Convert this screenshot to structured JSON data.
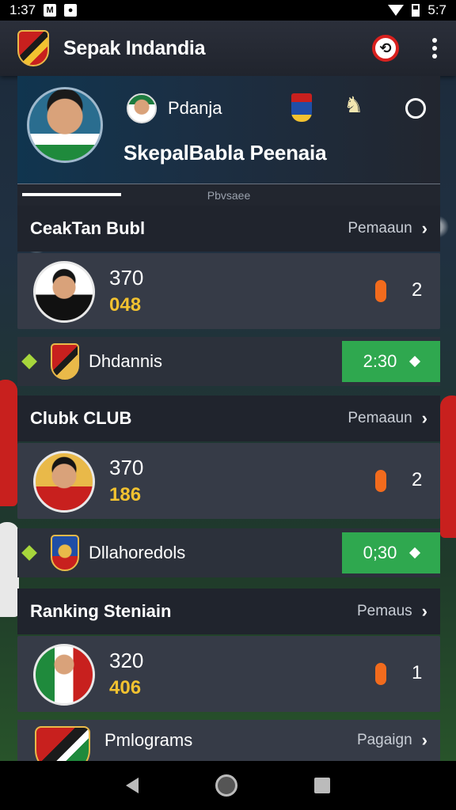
{
  "status_bar": {
    "time_left": "1:37",
    "time_right": "5:7",
    "icon_a": "M"
  },
  "app_bar": {
    "title": "Sepak Indandia",
    "clock_icon": "clock-icon",
    "menu_icon": "more-vert-icon"
  },
  "profile": {
    "name_primary": "Pdanja",
    "name_secondary": "SkepalBabla Peenaia",
    "progress_label": "Pbvsaee",
    "progress_fraction": 0.24
  },
  "sections": [
    {
      "title": "CeakTan Bubl",
      "link": "Pemaaun",
      "stat": {
        "value_top": "370",
        "value_bottom": "048",
        "count": "2"
      },
      "match": {
        "name": "Dhdannis",
        "score": "2:30"
      }
    },
    {
      "title": "Clubk CLUB",
      "link": "Pemaaun",
      "stat": {
        "value_top": "370",
        "value_bottom": "186",
        "count": "2"
      },
      "match": {
        "name": "Dllahoredols",
        "score": "0;30"
      }
    },
    {
      "title": "Ranking Steniain",
      "link": "Pemaus",
      "stat": {
        "value_top": "320",
        "value_bottom": "406",
        "count": "1"
      }
    }
  ],
  "last_row": {
    "name": "Pmlograms",
    "link": "Pagaign"
  },
  "colors": {
    "accent_green": "#2fa84f",
    "accent_orange": "#f26b1d",
    "accent_gold": "#f2c230"
  }
}
